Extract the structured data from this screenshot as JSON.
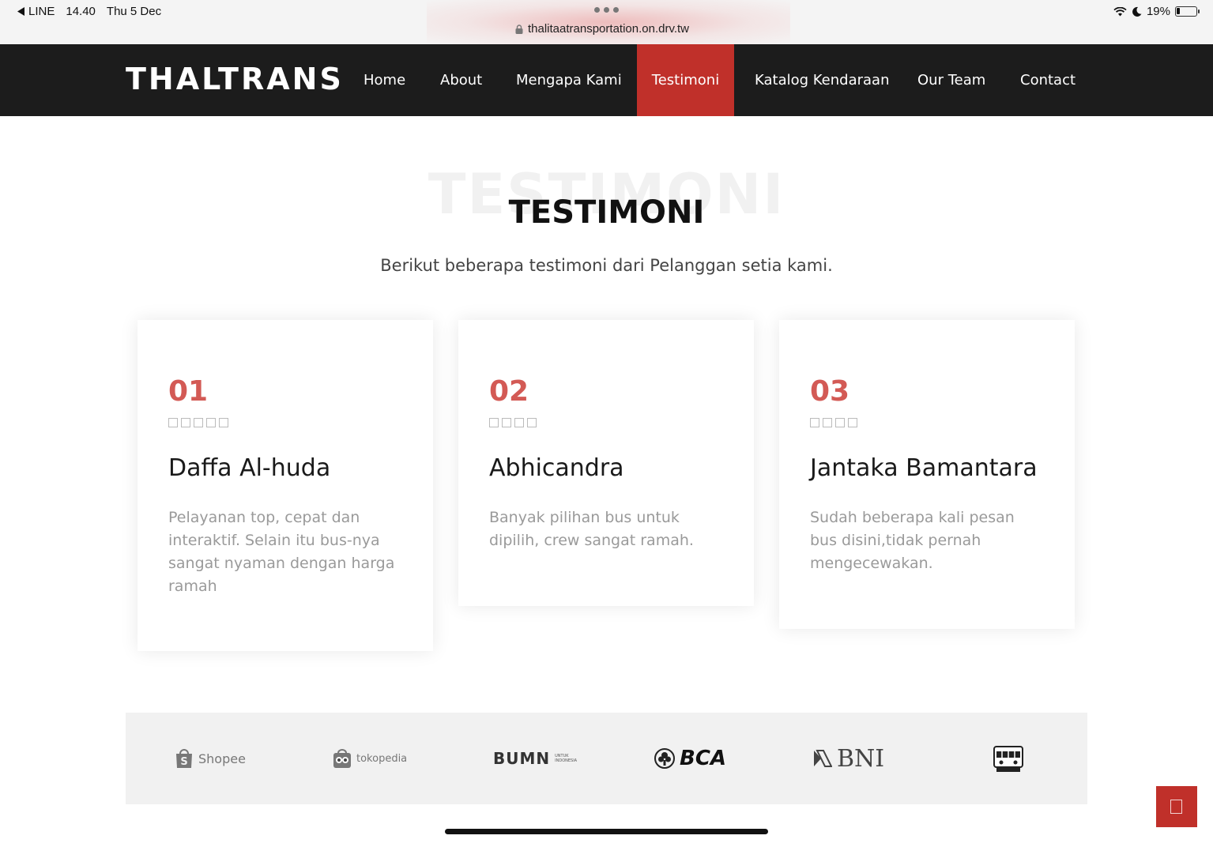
{
  "status_bar": {
    "back_app": "LINE",
    "time": "14.40",
    "date": "Thu 5 Dec",
    "url": "thalitaatransportation.on.drv.tw",
    "battery": "19%",
    "battery_level": 0.19
  },
  "navbar": {
    "brand": "THALTRANS",
    "items": [
      {
        "label": "Home"
      },
      {
        "label": "About"
      },
      {
        "label": "Mengapa Kami"
      },
      {
        "label": "Testimoni"
      },
      {
        "label": "Katalog Kendaraan"
      },
      {
        "label": "Our Team"
      },
      {
        "label": "Contact"
      }
    ],
    "active_item": "Testimoni"
  },
  "section": {
    "bg_title": "TESTIMONI",
    "title": "TESTIMONI",
    "subtitle": "Berikut beberapa testimoni dari Pelanggan setia kami."
  },
  "testimonials": [
    {
      "number": "01",
      "stars": 5,
      "name": "Daffa Al-huda",
      "text": "Pelayanan top, cepat dan interaktif. Selain itu bus-nya sangat nyaman dengan harga ramah"
    },
    {
      "number": "02",
      "stars": 4,
      "name": "Abhicandra",
      "text": "Banyak pilihan bus untuk dipilih, crew sangat ramah."
    },
    {
      "number": "03",
      "stars": 4,
      "name": "Jantaka Bamantara",
      "text": "Sudah beberapa kali pesan bus disini,tidak pernah mengecewakan."
    }
  ],
  "clients": [
    {
      "name": "Shopee",
      "icon": "shopee-logo"
    },
    {
      "name": "tokopedia",
      "icon": "tokopedia-logo"
    },
    {
      "name": "BUMN",
      "icon": "bumn-logo",
      "tagline": "UNTUK INDONESIA"
    },
    {
      "name": "BCA",
      "icon": "bca-logo"
    },
    {
      "name": "BNI",
      "icon": "bni-logo"
    },
    {
      "name": "THALTRANS",
      "icon": "thaltrans-bus-logo"
    }
  ],
  "colors": {
    "accent": "#c0302a",
    "number": "#d35a55",
    "navbar_bg": "#1c1c1c",
    "clients_bg": "#f1f1f1"
  }
}
